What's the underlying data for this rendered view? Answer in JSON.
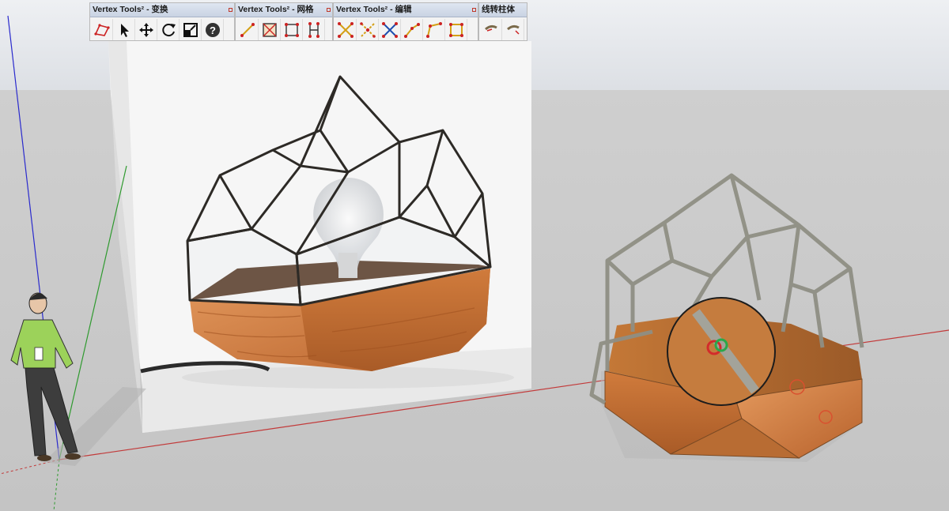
{
  "app": "SketchUp",
  "toolbars": [
    {
      "title": "Vertex Tools² - 变换",
      "buttons": [
        "select-region-icon",
        "select-arrow-icon",
        "move-icon",
        "rotate-icon",
        "scale-icon",
        "help-icon"
      ]
    },
    {
      "title": "Vertex Tools² - 网格",
      "buttons": [
        "line-vertex-icon",
        "quad-grid-icon",
        "mesh-grid-icon",
        "vertical-grid-icon"
      ]
    },
    {
      "title": "Vertex Tools² - 编辑",
      "buttons": [
        "merge-vertices-icon",
        "weld-vertices-icon",
        "split-vertices-icon",
        "draw-edge-icon",
        "connect-edge-icon",
        "triangulate-icon"
      ]
    },
    {
      "title": "线转柱体",
      "buttons": [
        "line-to-pipe-icon",
        "pipe-end-icon"
      ]
    }
  ],
  "scene": {
    "sky_color": "#e2e5ea",
    "ground_color": "#cbcbcb",
    "axis_colors": {
      "red": "#c23a3a",
      "green": "#2f9a2f",
      "blue": "#2a2acd"
    },
    "reference_image": "geometric glass terrarium lamp on hexagonal wooden base",
    "model": "wireframe terrarium model with wood base",
    "scale_figure": "person figure"
  }
}
